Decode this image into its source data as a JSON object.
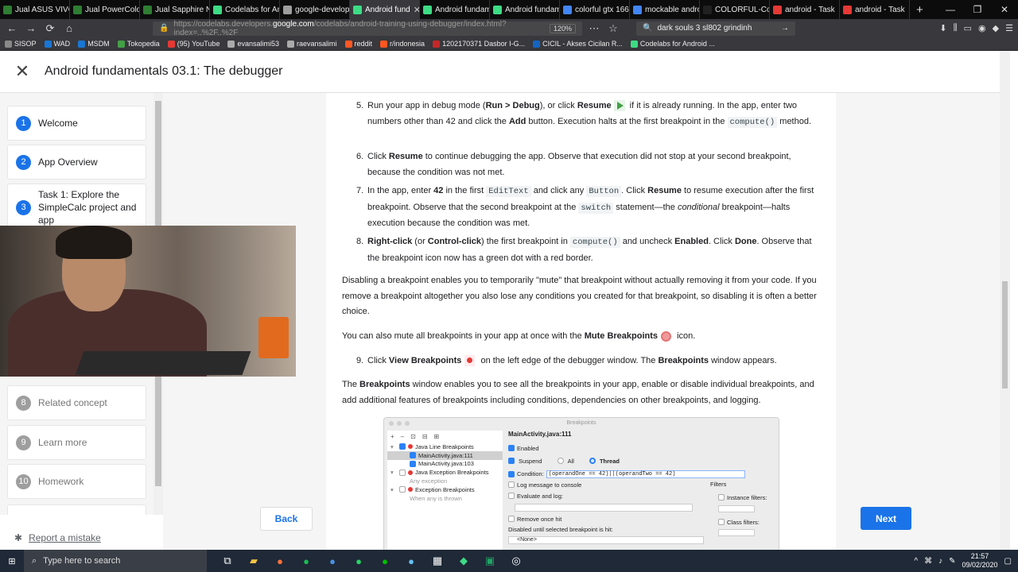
{
  "browser": {
    "tabs": [
      {
        "label": "Jual ASUS VIVOB",
        "color": "#2e7d32"
      },
      {
        "label": "Jual PowerColo",
        "color": "#2e7d32"
      },
      {
        "label": "Jual Sapphire Ni",
        "color": "#2e7d32"
      },
      {
        "label": "Codelabs for An",
        "color": "#3ddc84"
      },
      {
        "label": "google-develop",
        "color": "#9e9e9e"
      },
      {
        "label": "Android fund",
        "color": "#3ddc84"
      },
      {
        "label": "Android fundam",
        "color": "#3ddc84"
      },
      {
        "label": "Android fundam",
        "color": "#3ddc84"
      },
      {
        "label": "colorful gtx 166",
        "color": "#4285f4"
      },
      {
        "label": "mockable andro",
        "color": "#4285f4"
      },
      {
        "label": "COLORFUL-Colorful",
        "color": "#212121"
      },
      {
        "label": "android - Task",
        "color": "#e53935"
      },
      {
        "label": "android - Task",
        "color": "#e53935"
      }
    ],
    "url_prefix": "https://codelabs.developers.",
    "url_domain": "google.com",
    "url_suffix": "/codelabs/android-training-using-debugger/index.html?index=..%2F..%2F",
    "zoom": "120%",
    "search_text": "dark souls 3 sl802 grindinh",
    "bookmarks": [
      {
        "label": "SISOP",
        "color": "#888"
      },
      {
        "label": "WAD",
        "color": "#1976d2"
      },
      {
        "label": "MSDM",
        "color": "#1976d2"
      },
      {
        "label": "Tokopedia",
        "color": "#43a047"
      },
      {
        "label": "(95) YouTube",
        "color": "#e53935"
      },
      {
        "label": "evansalimi53",
        "color": "#aaa"
      },
      {
        "label": "raevansalimi",
        "color": "#aaa"
      },
      {
        "label": "reddit",
        "color": "#ff5722"
      },
      {
        "label": "r/indonesia",
        "color": "#ff5722"
      },
      {
        "label": "1202170371 Dasbor I-G...",
        "color": "#c62828"
      },
      {
        "label": "CICIL - Akses Cicilan R...",
        "color": "#1565c0"
      },
      {
        "label": "Codelabs for Android ...",
        "color": "#3ddc84"
      }
    ]
  },
  "page": {
    "title": "Android fundamentals 03.1: The debugger"
  },
  "sidebar": {
    "steps": [
      {
        "num": "1",
        "label": "Welcome"
      },
      {
        "num": "2",
        "label": "App Overview"
      },
      {
        "num": "3",
        "label": "Task 1: Explore the SimpleCalc project and app"
      },
      {
        "num": "8",
        "label": "Related concept"
      },
      {
        "num": "9",
        "label": "Learn more"
      },
      {
        "num": "10",
        "label": "Homework"
      }
    ],
    "report_label": "Report a mistake"
  },
  "nav": {
    "back": "Back",
    "next": "Next"
  },
  "content": {
    "step5": {
      "n": "5.",
      "t1": "Run your app in debug mode (",
      "b1": "Run > Debug",
      "t2": "), or click ",
      "b2": "Resume",
      "t3": " if it is already running. In the app, enter two numbers other than 42 and click the ",
      "b3": "Add",
      "t4": " button. Execution halts at the first breakpoint in the ",
      "c1": "compute()",
      "t5": " method."
    },
    "step6": {
      "n": "6.",
      "t1": "Click ",
      "b1": "Resume",
      "t2": " to continue debugging the app. Observe that execution did not stop at your second breakpoint, because the condition was not met."
    },
    "step7": {
      "n": "7.",
      "t1": "In the app, enter ",
      "b1": "42",
      "t2": " in the first ",
      "c1": "EditText",
      "t3": " and click any ",
      "c2": "Button",
      "t4": ". Click ",
      "b2": "Resume",
      "t5": " to resume execution after the first breakpoint. Observe that the second breakpoint at the ",
      "c3": "switch",
      "t6": " statement—the ",
      "i1": "conditional",
      "t7": " breakpoint—halts execution because the condition was met."
    },
    "step8": {
      "n": "8.",
      "b1": "Right-click",
      "t1": " (or ",
      "b2": "Control-click",
      "t2": ") the first breakpoint in ",
      "c1": "compute()",
      "t3": " and uncheck ",
      "b3": "Enabled",
      "t4": ". Click ",
      "b4": "Done",
      "t5": ". Observe that the breakpoint icon now has a green dot with a red border."
    },
    "para1": "Disabling a breakpoint enables you to temporarily \"mute\" that breakpoint without actually removing it from your code. If you remove a breakpoint altogether you also lose any conditions you created for that breakpoint, so disabling it is often a better choice.",
    "para2": {
      "t1": "You can also mute all breakpoints in your app at once with the ",
      "b1": "Mute Breakpoints",
      "t2": " icon."
    },
    "step9": {
      "n": "9.",
      "t1": "Click ",
      "b1": "View Breakpoints",
      "t2": " on the left edge of the debugger window. The ",
      "b2": "Breakpoints",
      "t3": " window appears."
    },
    "para3": {
      "t1": "The ",
      "b1": "Breakpoints",
      "t2": " window enables you to see all the breakpoints in your app, enable or disable individual breakpoints, and add additional features of breakpoints including conditions, dependencies on other breakpoints, and logging."
    }
  },
  "breakpoints_window": {
    "title": "Breakpoints",
    "toolbar": [
      "+",
      "–",
      "⊡",
      "⊟",
      "⊞"
    ],
    "tree": [
      {
        "label": "Java Line Breakpoints",
        "checked": true,
        "indent": 0
      },
      {
        "label": "MainActivity.java:111",
        "checked": true,
        "indent": 1
      },
      {
        "label": "MainActivity.java:103",
        "checked": true,
        "indent": 1
      },
      {
        "label": "Java Exception Breakpoints",
        "checked": false,
        "indent": 0
      },
      {
        "label": "Any exception",
        "checked": false,
        "indent": 1
      },
      {
        "label": "Exception Breakpoints",
        "checked": false,
        "indent": 0
      },
      {
        "label": "When any is thrown",
        "checked": false,
        "indent": 1
      }
    ],
    "detail_title": "MainActivity.java:111",
    "enabled": "Enabled",
    "suspend": "Suspend",
    "all": "All",
    "thread": "Thread",
    "condition_label": "Condition:",
    "condition_value": "(operandOne == 42)||(operandTwo == 42)",
    "log_message": "Log message to console",
    "evaluate": "Evaluate and log:",
    "remove_once": "Remove once hit",
    "disabled_until": "Disabled until selected breakpoint is hit:",
    "none": "<None>",
    "filters": "Filters",
    "instance_filters": "Instance filters:",
    "class_filters": "Class filters:"
  },
  "taskbar": {
    "search_placeholder": "Type here to search",
    "time": "21:57",
    "date": "09/02/2020"
  }
}
